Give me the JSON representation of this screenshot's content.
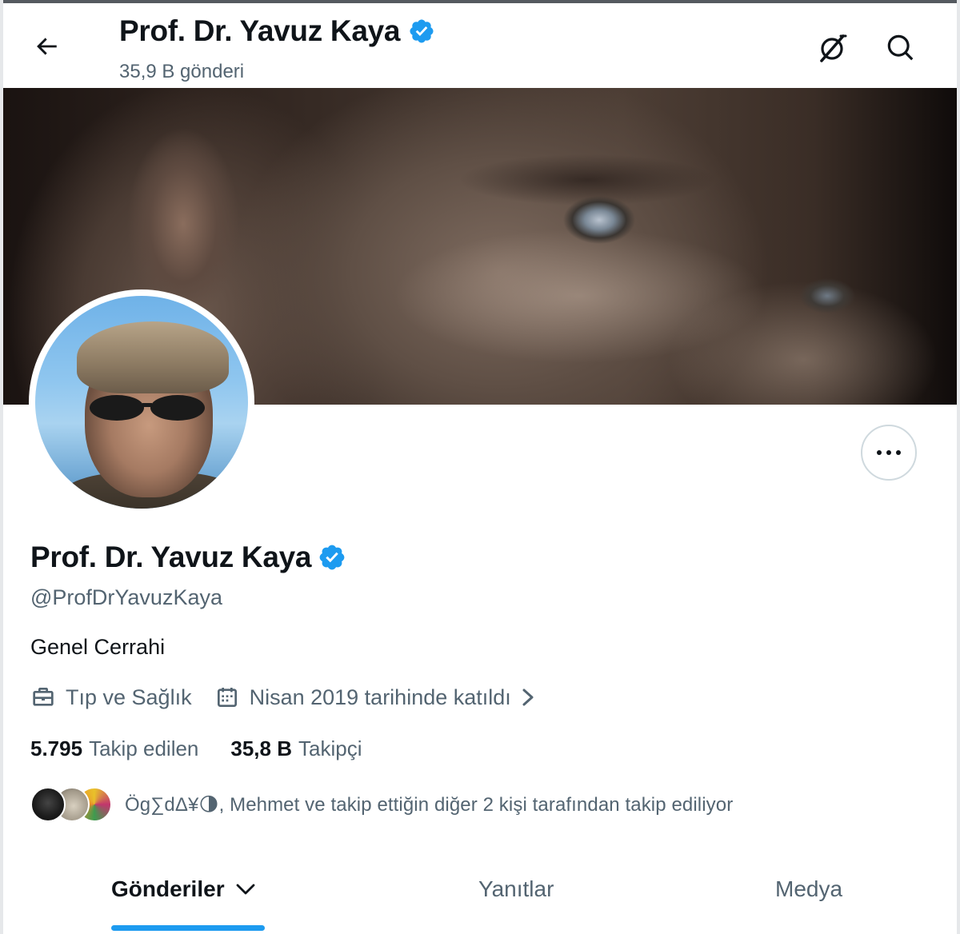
{
  "header": {
    "title": "Prof. Dr. Yavuz Kaya",
    "post_count": "35,9 B gönderi",
    "back_icon": "arrow-left-icon",
    "grok_icon": "grok-icon",
    "search_icon": "search-icon"
  },
  "profile": {
    "name": "Prof. Dr. Yavuz Kaya",
    "verified": true,
    "handle": "@ProfDrYavuzKaya",
    "bio": "Genel Cerrahi",
    "category": "Tıp ve Sağlık",
    "joined": "Nisan 2019 tarihinde katıldı",
    "following_count": "5.795",
    "following_label": "Takip edilen",
    "followers_count": "35,8 B",
    "followers_label": "Takipçi",
    "followed_by_text": "Ög∑dΔ¥🌗, Mehmet ve takip ettiğin diğer 2 kişi tarafından takip ediliyor"
  },
  "tabs": [
    {
      "label": "Gönderiler",
      "active": true
    },
    {
      "label": "Yanıtlar",
      "active": false
    },
    {
      "label": "Medya",
      "active": false
    }
  ],
  "colors": {
    "accent": "#1d9bf0",
    "verified_badge": "#1d9bf0",
    "secondary_text": "#536471",
    "primary_text": "#0f1419",
    "border": "#cfd9de"
  }
}
